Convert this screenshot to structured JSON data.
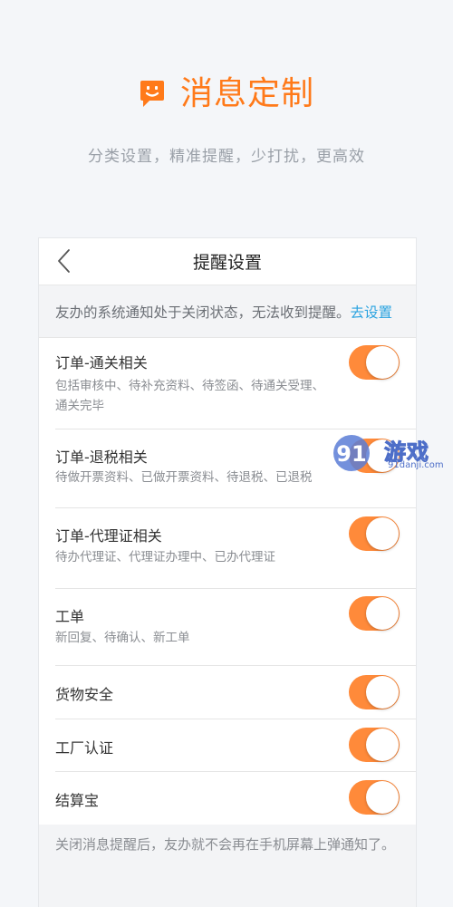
{
  "hero": {
    "title": "消息定制",
    "subtitle": "分类设置，精准提醒，少打扰，更高效",
    "icon": "chat-bubble-smile-icon",
    "accent_color": "#ff7a1a"
  },
  "nav": {
    "back_icon": "chevron-left-icon",
    "title": "提醒设置"
  },
  "notice": {
    "text": "友办的系统通知处于关闭状态，无法收到提醒。",
    "link": "去设置",
    "link_color": "#2aa3e0"
  },
  "settings": [
    {
      "title": "订单-通关相关",
      "desc_line1": "包括审核中、待补充资料、待签函、待通关受理、",
      "desc_line2": "通关完毕",
      "enabled": true
    },
    {
      "title": "订单-退税相关",
      "desc_line1": "待做开票资料、已做开票资料、待退税、已退税",
      "desc_line2": "",
      "enabled": true
    },
    {
      "title": "订单-代理证相关",
      "desc_line1": "待办代理证、代理证办理中、已办代理证",
      "desc_line2": "",
      "enabled": true
    },
    {
      "title": "工单",
      "desc_line1": "新回复、待确认、新工单",
      "desc_line2": "",
      "enabled": true
    },
    {
      "title": "货物安全",
      "desc_line1": "",
      "desc_line2": "",
      "enabled": true
    },
    {
      "title": "工厂认证",
      "desc_line1": "",
      "desc_line2": "",
      "enabled": true
    },
    {
      "title": "结算宝",
      "desc_line1": "",
      "desc_line2": "",
      "enabled": true
    }
  ],
  "toggle_color": "#ff8a3a",
  "footer": {
    "note": "关闭消息提醒后，友办就不会再在手机屏幕上弹通知了。"
  },
  "watermark": {
    "text": "游戏",
    "url": "91danji.com"
  }
}
